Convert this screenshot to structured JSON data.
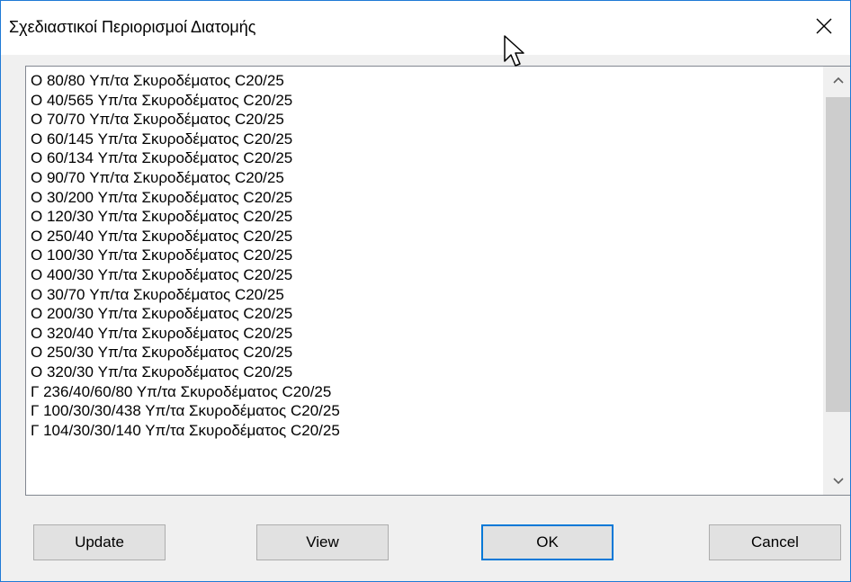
{
  "window": {
    "title": "Σχεδιαστικοί Περιορισμοί Διατομής"
  },
  "list": {
    "items": [
      "O 80/80 Υπ/τα Σκυροδέματος C20/25",
      "O 40/565 Υπ/τα Σκυροδέματος C20/25",
      "O 70/70 Υπ/τα Σκυροδέματος C20/25",
      "O 60/145 Υπ/τα Σκυροδέματος C20/25",
      "O 60/134 Υπ/τα Σκυροδέματος C20/25",
      "O 90/70 Υπ/τα Σκυροδέματος C20/25",
      "O 30/200 Υπ/τα Σκυροδέματος C20/25",
      "O 120/30 Υπ/τα Σκυροδέματος C20/25",
      "O 250/40 Υπ/τα Σκυροδέματος C20/25",
      "O 100/30 Υπ/τα Σκυροδέματος C20/25",
      "O 400/30 Υπ/τα Σκυροδέματος C20/25",
      "O 30/70 Υπ/τα Σκυροδέματος C20/25",
      "O 200/30 Υπ/τα Σκυροδέματος C20/25",
      "O 320/40 Υπ/τα Σκυροδέματος C20/25",
      "O 250/30 Υπ/τα Σκυροδέματος C20/25",
      "O 320/30 Υπ/τα Σκυροδέματος C20/25",
      "Γ 236/40/60/80 Υπ/τα Σκυροδέματος C20/25",
      "Γ 100/30/30/438 Υπ/τα Σκυροδέματος C20/25",
      "Γ 104/30/30/140 Υπ/τα Σκυροδέματος C20/25"
    ]
  },
  "buttons": {
    "update": "Update",
    "view": "View",
    "ok": "OK",
    "cancel": "Cancel"
  },
  "icons": {
    "close": "close-icon",
    "scroll_up": "chevron-up-icon",
    "scroll_down": "chevron-down-icon",
    "cursor": "mouse-pointer-icon"
  },
  "colors": {
    "window_border": "#1f7ad6",
    "default_button_border": "#0078d7",
    "scroll_thumb": "#cdcdcd"
  }
}
